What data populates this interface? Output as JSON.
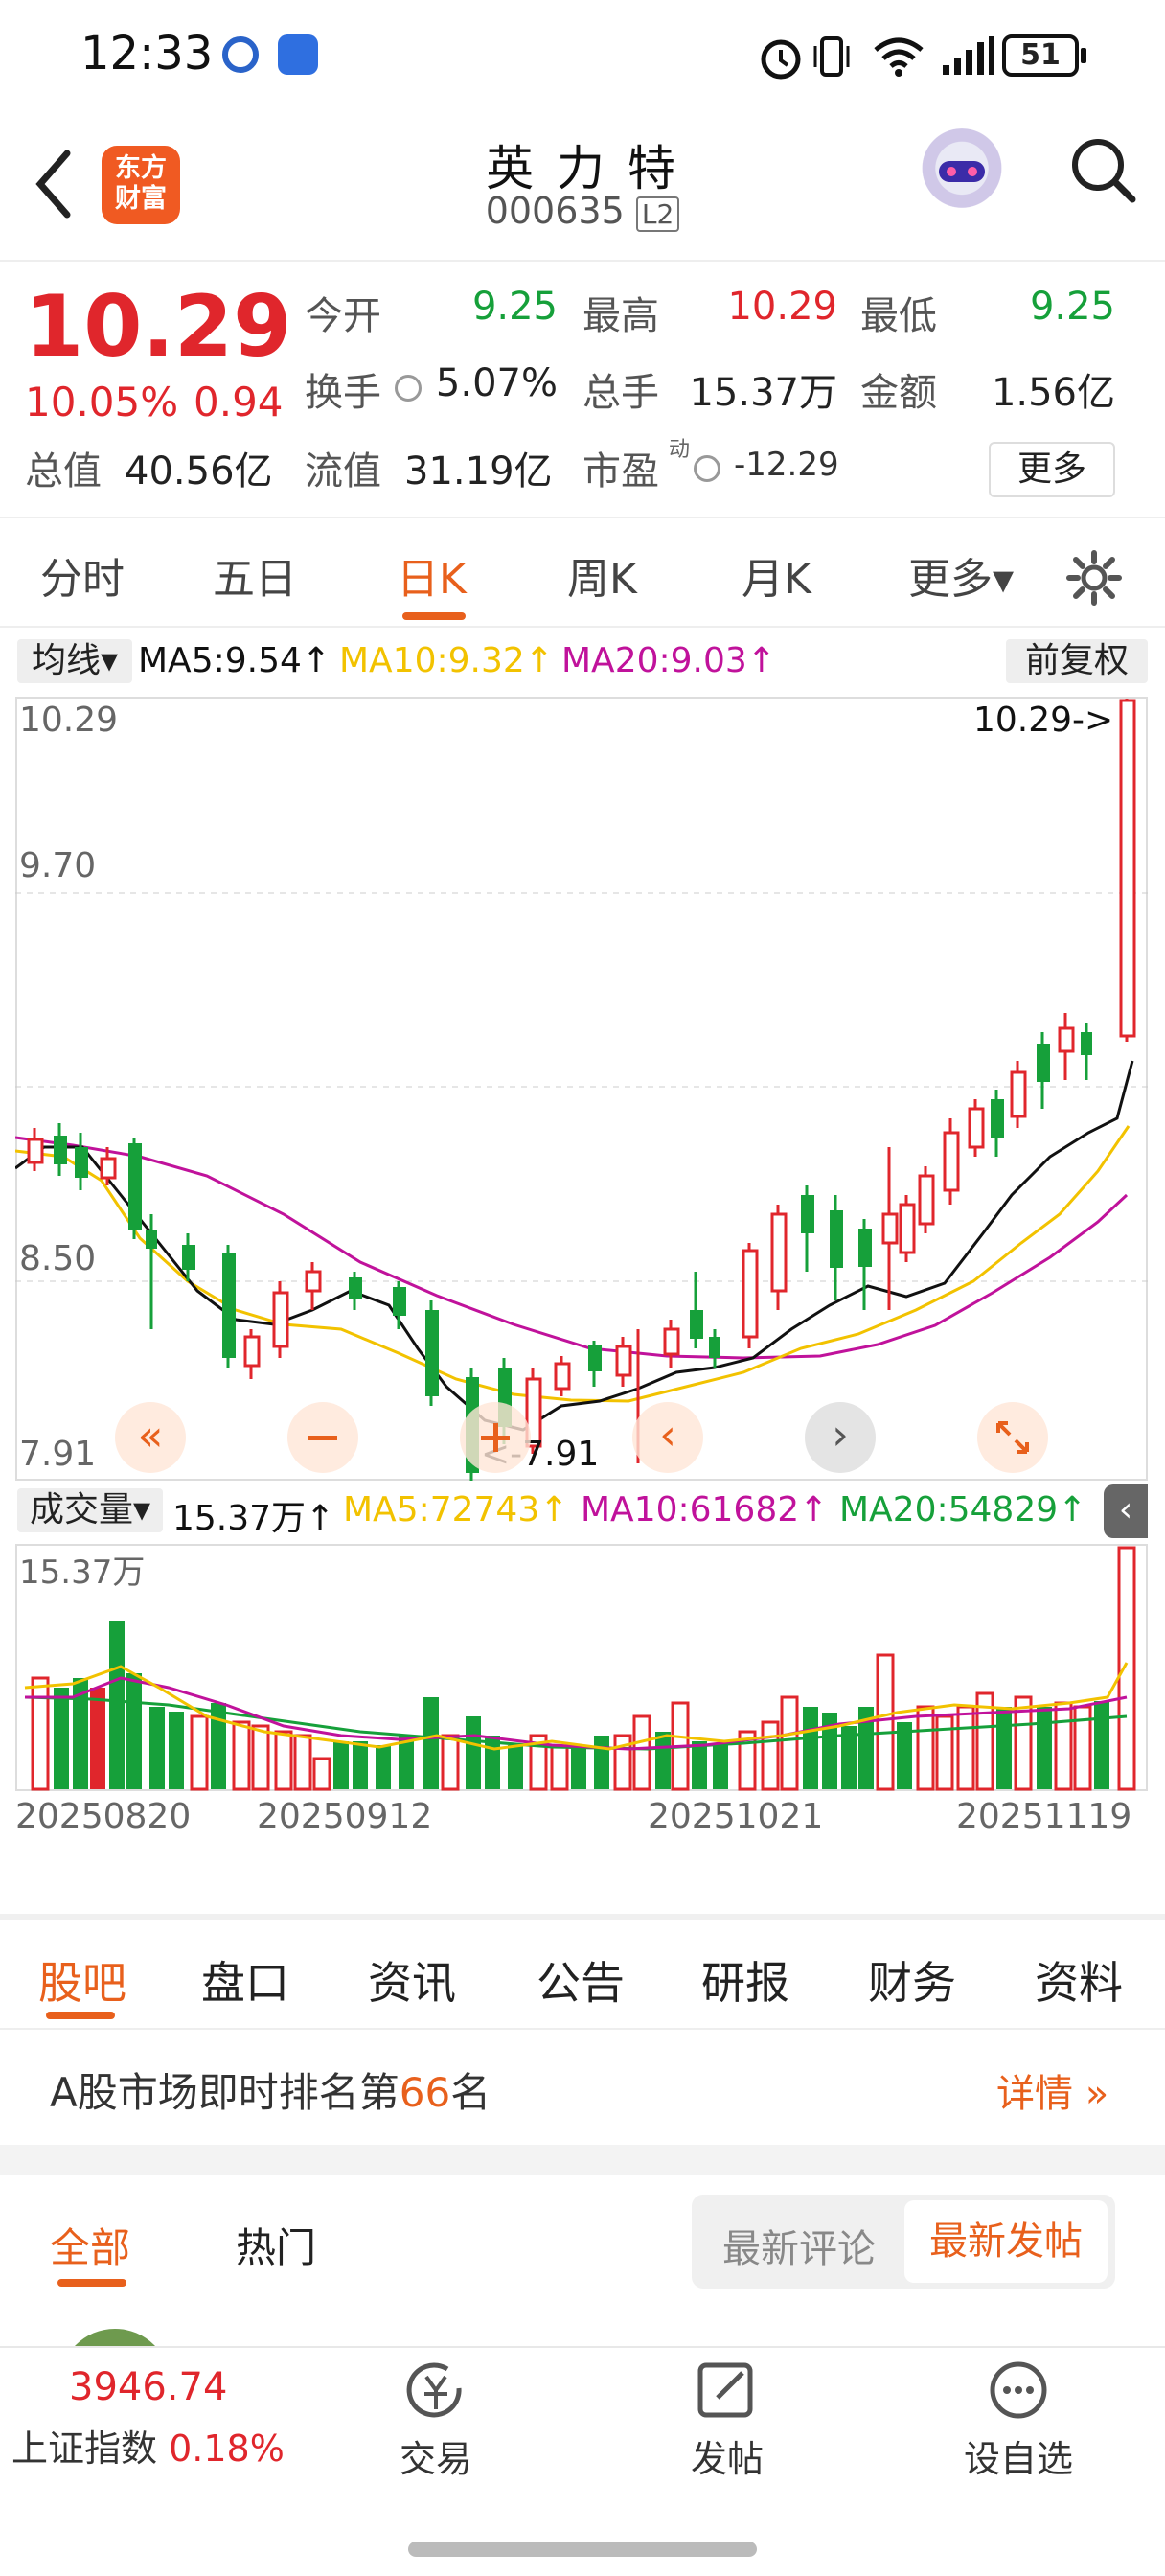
{
  "status_bar": {
    "time": "12:33",
    "battery": "51"
  },
  "header": {
    "stock_name": "英 力 特",
    "stock_code": "000635",
    "level_badge": "L2",
    "brand_logo_line1": "东方",
    "brand_logo_line2": "财富"
  },
  "quote": {
    "price": "10.29",
    "change_pct": "10.05%",
    "change": "0.94",
    "open_label": "今开",
    "open": "9.25",
    "high_label": "最高",
    "high": "10.29",
    "low_label": "最低",
    "low": "9.25",
    "turnover_label": "换手",
    "turnover": "5.07%",
    "volume_label": "总手",
    "volume": "15.37万",
    "amount_label": "金额",
    "amount": "1.56亿",
    "mktcap_label": "总值",
    "mktcap": "40.56亿",
    "float_label": "流值",
    "float": "31.19亿",
    "pe_label": "市盈",
    "pe_sup": "动",
    "pe": "-12.29",
    "more_label": "更多"
  },
  "tabs": [
    "分时",
    "五日",
    "日K",
    "周K",
    "月K",
    "更多▾"
  ],
  "chart": {
    "ma_selector": "均线▾",
    "ma5": "MA5:9.54↑",
    "ma10": "MA10:9.32↑",
    "ma20": "MA20:9.03↑",
    "adjust": "前复权",
    "y_labels": [
      "10.29",
      "9.70",
      "8.50",
      "7.91"
    ],
    "high_marker": "10.29->",
    "low_marker": "<-7.91",
    "vol_selector": "成交量▾",
    "vol_value": "15.37万↑",
    "vol_ma5": "MA5:72743↑",
    "vol_ma10": "MA10:61682↑",
    "vol_ma20": "MA20:54829↑",
    "vol_max": "15.37万",
    "dates": [
      "20250820",
      "20250912",
      "20251021",
      "20251119"
    ]
  },
  "chart_data": {
    "type": "candlestick",
    "price_range": [
      7.91,
      10.29
    ],
    "candles": []
  },
  "bottom_tabs": [
    "股吧",
    "盘口",
    "资讯",
    "公告",
    "研报",
    "财务",
    "资料"
  ],
  "rank": {
    "prefix": "A股市场即时排名第",
    "number": "66",
    "suffix": "名",
    "detail": "详情"
  },
  "sub_tabs": {
    "all": "全部",
    "hot": "热门",
    "latest_comment": "最新评论",
    "latest_post": "最新发帖"
  },
  "bottom_nav": {
    "index_value": "3946.74",
    "index_name": "上证指数",
    "index_change": "0.18%",
    "trade": "交易",
    "post": "发帖",
    "watchlist": "设自选"
  },
  "colors": {
    "up": "#e0262c",
    "down": "#16a03a",
    "accent": "#e8601c",
    "ma5": "#111111",
    "ma10": "#f2c200",
    "ma20": "#c0129b"
  }
}
